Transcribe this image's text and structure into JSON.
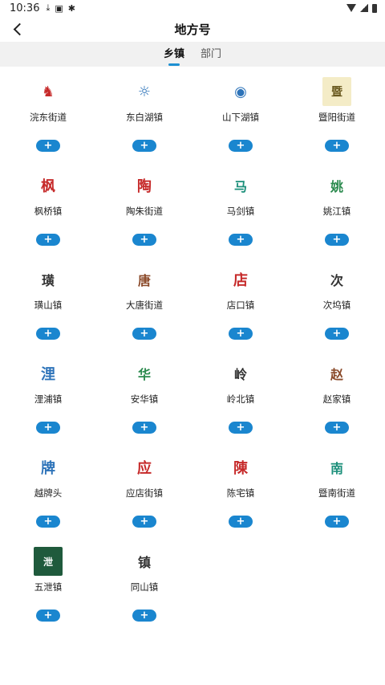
{
  "status": {
    "time": "10:36",
    "icons": [
      "download-icon",
      "image-icon",
      "bug-icon"
    ]
  },
  "header": {
    "title": "地方号"
  },
  "tabs": [
    {
      "label": "乡镇",
      "active": true
    },
    {
      "label": "部门",
      "active": false
    }
  ],
  "add_label": "+",
  "towns": [
    {
      "name": "浣东街道",
      "logo": "♞",
      "style": "lg-red"
    },
    {
      "name": "东白湖镇",
      "logo": "☼",
      "style": "lg-blue"
    },
    {
      "name": "山下湖镇",
      "logo": "◉",
      "style": "lg-blue"
    },
    {
      "name": "暨阳街道",
      "logo": "暨",
      "style": "lg-cream"
    },
    {
      "name": "枫桥镇",
      "logo": "枫",
      "style": "lg-red"
    },
    {
      "name": "陶朱街道",
      "logo": "陶",
      "style": "lg-red"
    },
    {
      "name": "马剑镇",
      "logo": "马",
      "style": "lg-teal"
    },
    {
      "name": "姚江镇",
      "logo": "姚",
      "style": "lg-green"
    },
    {
      "name": "璜山镇",
      "logo": "璜",
      "style": "lg-dark"
    },
    {
      "name": "大唐街道",
      "logo": "唐",
      "style": "lg-brown"
    },
    {
      "name": "店口镇",
      "logo": "店",
      "style": "lg-red"
    },
    {
      "name": "次坞镇",
      "logo": "次",
      "style": "lg-dark"
    },
    {
      "name": "浬浦镇",
      "logo": "浬",
      "style": "lg-blue"
    },
    {
      "name": "安华镇",
      "logo": "华",
      "style": "lg-green"
    },
    {
      "name": "岭北镇",
      "logo": "岭",
      "style": "lg-dark"
    },
    {
      "name": "赵家镇",
      "logo": "赵",
      "style": "lg-brown"
    },
    {
      "name": "越牌头",
      "logo": "牌",
      "style": "lg-blue"
    },
    {
      "name": "应店街镇",
      "logo": "应",
      "style": "lg-red"
    },
    {
      "name": "陈宅镇",
      "logo": "陳",
      "style": "lg-red"
    },
    {
      "name": "暨南街道",
      "logo": "南",
      "style": "lg-teal"
    },
    {
      "name": "五泄镇",
      "logo": "泄",
      "style": "lg-darkgreen"
    },
    {
      "name": "同山镇",
      "logo": "镇",
      "style": "lg-dark"
    }
  ]
}
